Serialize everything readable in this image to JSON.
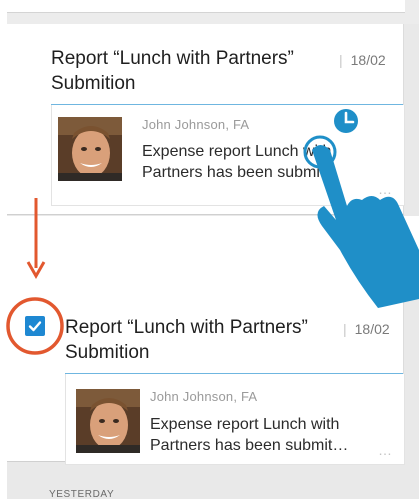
{
  "before_card": {
    "title": "Report “Lunch with Partners” Submition",
    "date": "18/02",
    "sender": "John Johnson, FA",
    "message": "Expense report Lunch with Partners has been submi…",
    "more": "…"
  },
  "after_card": {
    "title": "Report “Lunch with Partners” Submition",
    "date": "18/02",
    "sender": "John Johnson, FA",
    "message": "Expense report Lunch with Partners has been submit…",
    "more": "…",
    "checked": true
  },
  "section": {
    "label": "YESTERDAY"
  },
  "colors": {
    "accent": "#1e88d2",
    "annotation": "#e2582f",
    "hand": "#1f8fc8"
  },
  "icons": [
    "clock-icon",
    "tap-hand-icon",
    "arrow-down-icon",
    "check-icon"
  ]
}
